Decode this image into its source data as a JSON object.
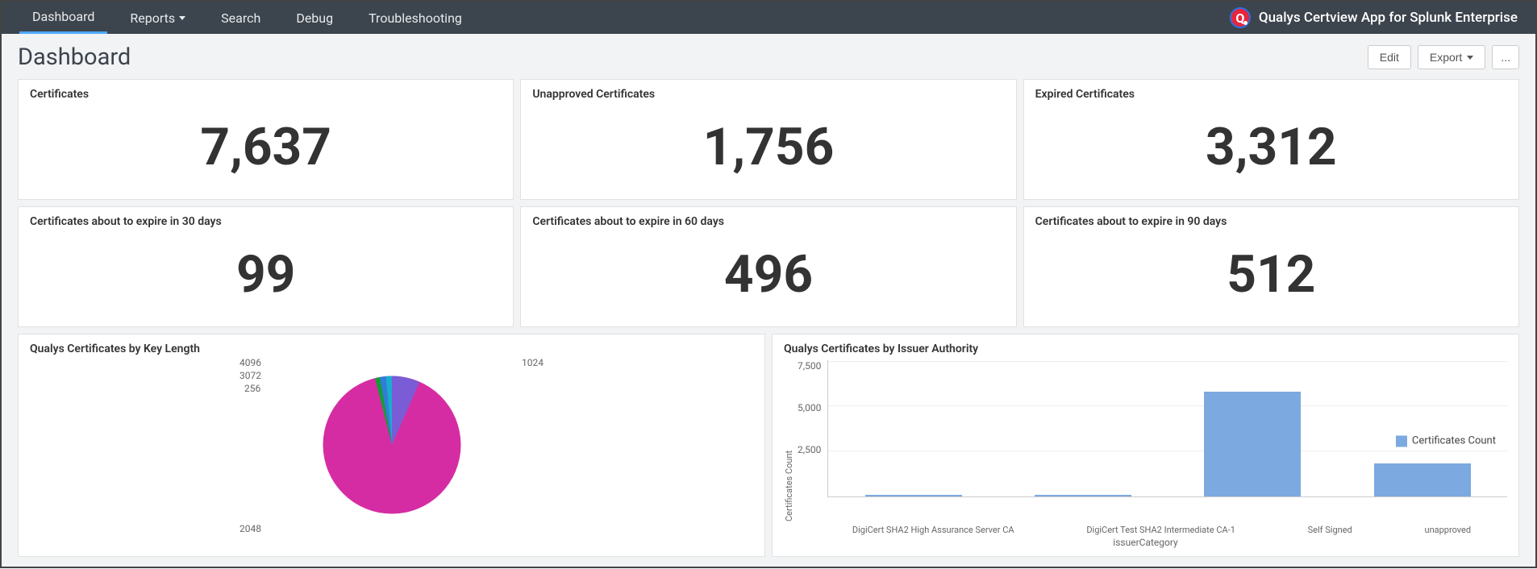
{
  "nav": {
    "items": [
      "Dashboard",
      "Reports",
      "Search",
      "Debug",
      "Troubleshooting"
    ],
    "app_title": "Qualys Certview App for Splunk Enterprise"
  },
  "header": {
    "title": "Dashboard",
    "edit_label": "Edit",
    "export_label": "Export",
    "more_label": "..."
  },
  "stats": [
    {
      "title": "Certificates",
      "value": "7,637"
    },
    {
      "title": "Unapproved Certificates",
      "value": "1,756"
    },
    {
      "title": "Expired Certificates",
      "value": "3,312"
    },
    {
      "title": "Certificates about to expire in 30 days",
      "value": "99"
    },
    {
      "title": "Certificates about to expire in 60 days",
      "value": "496"
    },
    {
      "title": "Certificates about to expire in 90 days",
      "value": "512"
    }
  ],
  "charts": {
    "pie": {
      "title": "Qualys Certificates by Key Length",
      "labels": {
        "l1024": "1024",
        "l2048": "2048",
        "l256": "256",
        "l3072": "3072",
        "l4096": "4096"
      }
    },
    "bar": {
      "title": "Qualys Certificates by Issuer Authority",
      "ylabel": "Certificates Count",
      "xlabel": "issuerCategory",
      "yticks": {
        "t7500": "7,500",
        "t5000": "5,000",
        "t2500": "2,500"
      },
      "categories": {
        "c0": "DigiCert SHA2 High Assurance Server CA",
        "c1": "DigiCert Test SHA2 Intermediate CA-1",
        "c2": "Self Signed",
        "c3": "unapproved"
      },
      "legend": "Certificates Count"
    }
  },
  "chart_data": [
    {
      "type": "pie",
      "title": "Qualys Certificates by Key Length",
      "categories": [
        "2048",
        "1024",
        "3072",
        "4096",
        "256"
      ],
      "values": [
        7250,
        230,
        60,
        60,
        37
      ],
      "colors": [
        "#d62ca3",
        "#7a5cd6",
        "#2f7ed8",
        "#1aadce",
        "#10a030"
      ]
    },
    {
      "type": "bar",
      "title": "Qualys Certificates by Issuer Authority",
      "xlabel": "issuerCategory",
      "ylabel": "Certificates Count",
      "categories": [
        "DigiCert SHA2 High Assurance Server CA",
        "DigiCert Test SHA2 Intermediate CA-1",
        "Self Signed",
        "unapproved"
      ],
      "series": [
        {
          "name": "Certificates Count",
          "values": [
            40,
            30,
            5800,
            1800
          ]
        }
      ],
      "ylim": [
        0,
        7500
      ]
    }
  ]
}
